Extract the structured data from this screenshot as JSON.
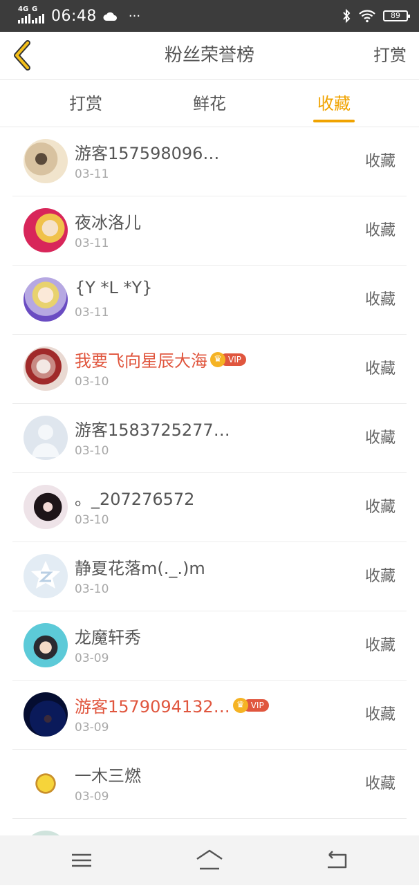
{
  "status_bar": {
    "network": "4G",
    "hd": "HD",
    "network2": "G",
    "time": "06:48",
    "more": "···",
    "battery": "89"
  },
  "header": {
    "title": "粉丝荣誉榜",
    "right_action": "打赏"
  },
  "tabs": [
    {
      "label": "打赏",
      "active": false
    },
    {
      "label": "鲜花",
      "active": false
    },
    {
      "label": "收藏",
      "active": true
    }
  ],
  "colors": {
    "accent": "#f0a300",
    "vip": "#e0563e",
    "statusbar": "#3c3c3c"
  },
  "vip_label": "VIP",
  "fans": [
    {
      "name": "游客157598096…",
      "date": "03-11",
      "action": "收藏",
      "vip": false
    },
    {
      "name": "夜冰洛儿",
      "date": "03-11",
      "action": "收藏",
      "vip": false
    },
    {
      "name": "{Y *L *Y}",
      "date": "03-11",
      "action": "收藏",
      "vip": false
    },
    {
      "name": "我要飞向星辰大海",
      "date": "03-10",
      "action": "收藏",
      "vip": true
    },
    {
      "name": "游客1583725277…",
      "date": "03-10",
      "action": "收藏",
      "vip": false
    },
    {
      "name": "。_207276572",
      "date": "03-10",
      "action": "收藏",
      "vip": false
    },
    {
      "name": "静夏花落m(._.)m",
      "date": "03-10",
      "action": "收藏",
      "vip": false
    },
    {
      "name": "龙魔轩秀",
      "date": "03-09",
      "action": "收藏",
      "vip": false
    },
    {
      "name": "游客1579094132…",
      "date": "03-09",
      "action": "收藏",
      "vip": true
    },
    {
      "name": "一木三燃",
      "date": "03-09",
      "action": "收藏",
      "vip": false
    }
  ]
}
